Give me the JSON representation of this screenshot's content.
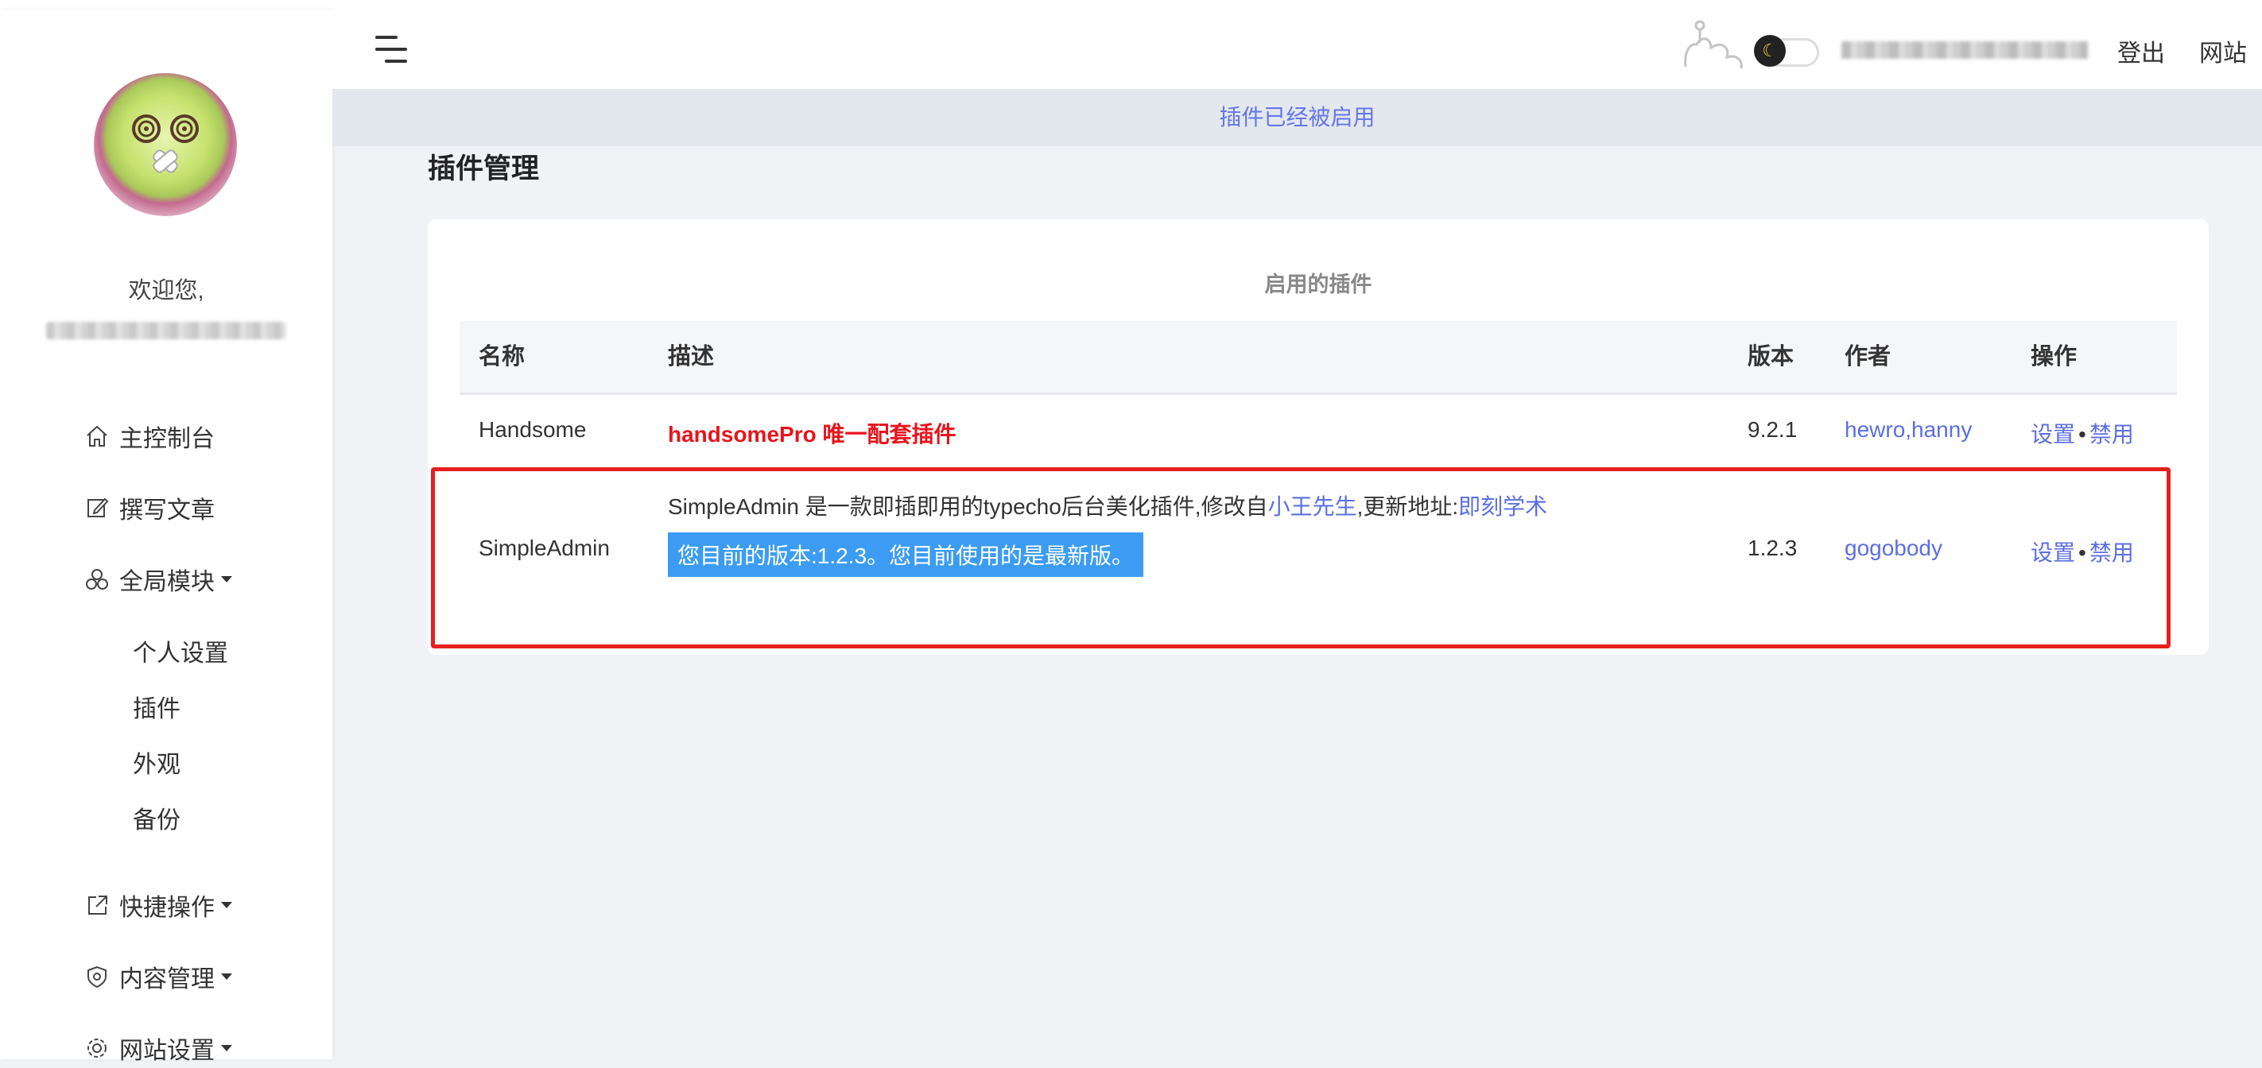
{
  "sidebar": {
    "welcome": "欢迎您,",
    "nav": [
      {
        "label": "主控制台",
        "icon": "home-icon"
      },
      {
        "label": "撰写文章",
        "icon": "edit-icon"
      },
      {
        "label": "全局模块",
        "icon": "modules-icon"
      },
      {
        "label": "快捷操作",
        "icon": "external-link-icon"
      },
      {
        "label": "内容管理",
        "icon": "shield-icon"
      },
      {
        "label": "网站设置",
        "icon": "gear-icon"
      }
    ],
    "sub_items": [
      "个人设置",
      "插件",
      "外观",
      "备份"
    ]
  },
  "header": {
    "logout": "登出",
    "site": "网站"
  },
  "notice": "插件已经被启用",
  "page_title": "插件管理",
  "table": {
    "caption": "启用的插件",
    "columns": [
      "名称",
      "描述",
      "版本",
      "作者",
      "操作"
    ],
    "rows": [
      {
        "name": "Handsome",
        "description": "handsomePro 唯一配套插件",
        "version": "9.2.1",
        "author": "hewro,hanny",
        "actions": [
          "设置",
          "禁用"
        ]
      },
      {
        "name": "SimpleAdmin",
        "desc_text1": "SimpleAdmin 是一款即插即用的typecho后台美化插件,修改自",
        "desc_link1": "小王先生",
        "desc_text2": ",更新地址:",
        "desc_link2": "即刻学术",
        "desc_notice": "您目前的版本:1.2.3。您目前使用的是最新版。",
        "version": "1.2.3",
        "author": "gogobody",
        "actions": [
          "设置",
          "禁用"
        ]
      }
    ]
  },
  "colors": {
    "accent": "#5b6fe0",
    "highlight_border": "#e61f1f",
    "notice_bg": "#3c9cf3",
    "red_text": "#e8141c"
  }
}
